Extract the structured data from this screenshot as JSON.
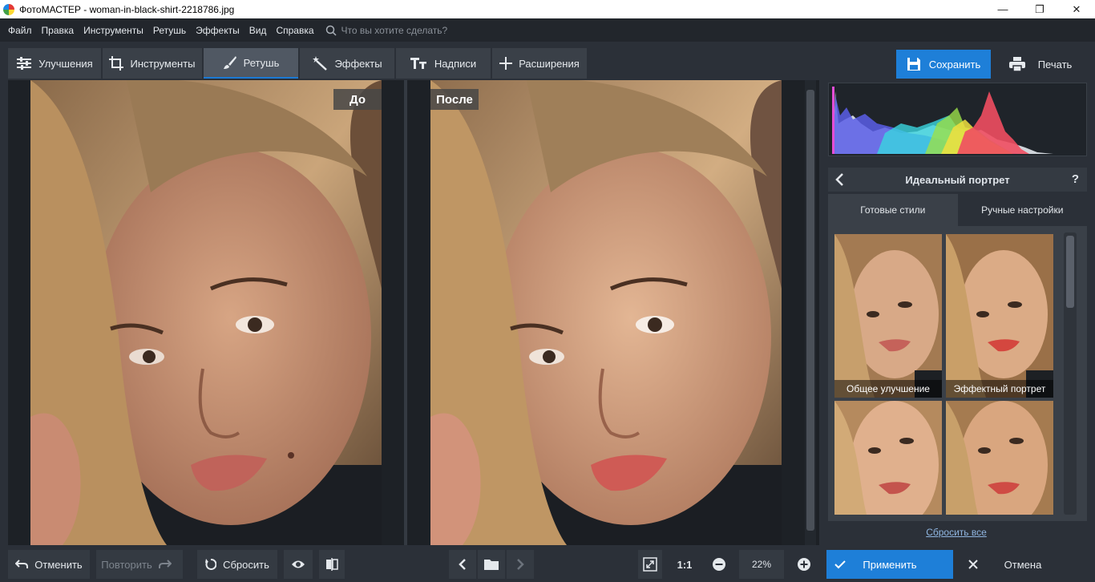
{
  "window": {
    "title": "ФотоМАСТЕР - woman-in-black-shirt-2218786.jpg",
    "minimize": "—",
    "maximize": "❐",
    "close": "✕"
  },
  "menu": {
    "items": [
      "Файл",
      "Правка",
      "Инструменты",
      "Ретушь",
      "Эффекты",
      "Вид",
      "Справка"
    ],
    "search_placeholder": "Что вы хотите сделать?"
  },
  "tabs": [
    {
      "label": "Улучшения",
      "icon": "sliders-icon",
      "active": false
    },
    {
      "label": "Инструменты",
      "icon": "crop-icon",
      "active": false
    },
    {
      "label": "Ретушь",
      "icon": "brush-icon",
      "active": true
    },
    {
      "label": "Эффекты",
      "icon": "magic-wand-icon",
      "active": false
    },
    {
      "label": "Надписи",
      "icon": "text-icon",
      "active": false
    },
    {
      "label": "Расширения",
      "icon": "plus-icon",
      "active": false
    }
  ],
  "toolbar": {
    "save_label": "Сохранить",
    "print_label": "Печать"
  },
  "canvas": {
    "before_label": "До",
    "after_label": "После"
  },
  "panel": {
    "title": "Идеальный портрет",
    "help": "?",
    "tab_ready": "Готовые стили",
    "tab_manual": "Ручные настройки",
    "styles": [
      {
        "label": "Общее улучшение"
      },
      {
        "label": "Эффектный портрет"
      },
      {
        "label": ""
      },
      {
        "label": ""
      }
    ],
    "reset_all": "Сбросить все"
  },
  "bottom": {
    "undo_label": "Отменить",
    "redo_label": "Повторить",
    "reset_label": "Сбросить",
    "zoom_one": "1:1",
    "zoom_value": "22%",
    "apply_label": "Применить",
    "cancel_label": "Отмена"
  },
  "colors": {
    "accent": "#1e7fd8",
    "background": "#2b3038",
    "canvas": "#1d2126"
  }
}
